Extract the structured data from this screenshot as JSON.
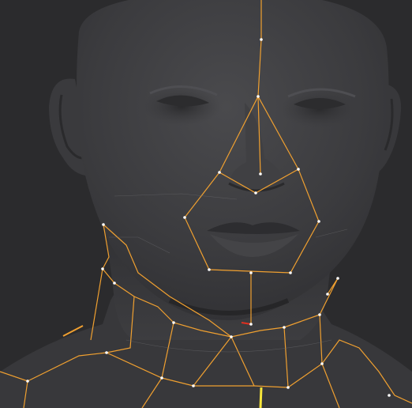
{
  "viewport": {
    "label": "",
    "background": "#2b2b2d",
    "model_color": "#3c3c3f",
    "topology_color": "#f0a030",
    "vertex_color": "#ffffff",
    "selection_color": "#f6e53a"
  },
  "icons": {
    "model": "sculpt-mesh",
    "topology": "retopology-guide-lines"
  }
}
